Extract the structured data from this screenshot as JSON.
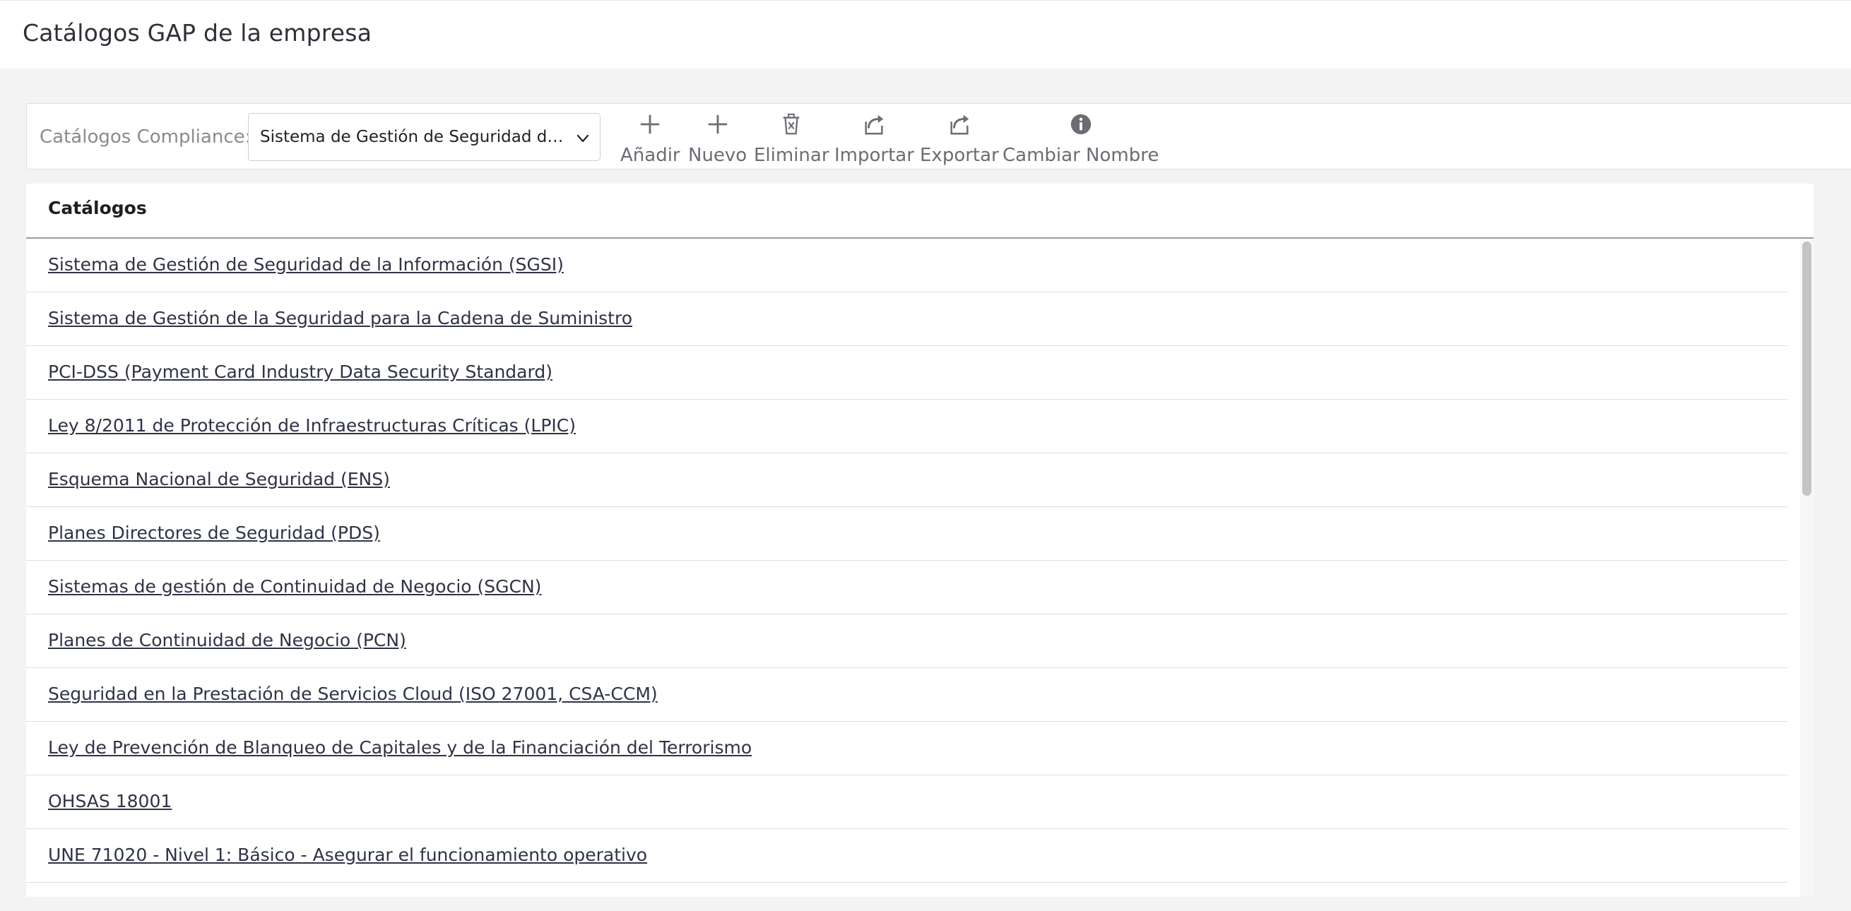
{
  "header": {
    "title": "Catálogos GAP de la empresa"
  },
  "toolbar": {
    "label": "Catálogos Compliance:",
    "select": {
      "value": "Sistema de Gestión de Seguridad de la Información (SGSI)"
    },
    "buttons": [
      {
        "label": "Añadir",
        "icon": "plus-icon"
      },
      {
        "label": "Nuevo",
        "icon": "plus-icon"
      },
      {
        "label": "Eliminar",
        "icon": "trash-icon"
      },
      {
        "label": "Importar",
        "icon": "share-arrow-icon"
      },
      {
        "label": "Exportar",
        "icon": "share-arrow-icon"
      },
      {
        "label": "Cambiar Nombre",
        "icon": "info-icon"
      }
    ]
  },
  "list": {
    "header": "Catálogos",
    "items": [
      "Sistema de Gestión de Seguridad de la Información (SGSI)",
      "Sistema de Gestión de la Seguridad para la Cadena de Suministro",
      "PCI-DSS (Payment Card Industry Data Security Standard)",
      "Ley 8/2011 de Protección de Infraestructuras Críticas (LPIC)",
      "Esquema Nacional de Seguridad (ENS)",
      "Planes Directores de Seguridad (PDS)",
      "Sistemas de gestión de Continuidad de Negocio (SGCN)",
      "Planes de Continuidad de Negocio (PCN)",
      "Seguridad en la Prestación de Servicios Cloud (ISO 27001, CSA-CCM)",
      "Ley de Prevención de Blanqueo de Capitales y de la Financiación del Terrorismo",
      "OHSAS 18001",
      "UNE 71020 - Nivel 1: Básico - Asegurar el funcionamiento operativo"
    ]
  },
  "colors": {
    "page_bg": "#f3f3f3",
    "panel_bg": "#ffffff",
    "link_text": "#2f3346",
    "icon_gray": "#6c6c74"
  }
}
